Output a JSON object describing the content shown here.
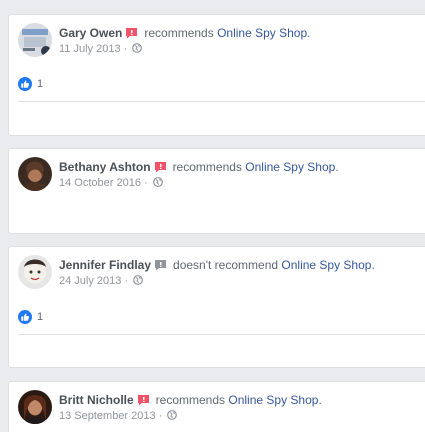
{
  "reviews": [
    {
      "author": "Gary Owen",
      "verb": "recommends",
      "page": "Online Spy Shop",
      "punct": ".",
      "date": "11 July 2013",
      "separator": "·",
      "likes": "1",
      "recommend_color": "#f25268"
    },
    {
      "author": "Bethany Ashton",
      "verb": "recommends",
      "page": "Online Spy Shop",
      "punct": ".",
      "date": "14 October 2016",
      "separator": "·",
      "likes": "",
      "recommend_color": "#f25268"
    },
    {
      "author": "Jennifer Findlay",
      "verb": "doesn't recommend",
      "page": "Online Spy Shop",
      "punct": ".",
      "date": "24 July 2013",
      "separator": "·",
      "likes": "1",
      "recommend_color": "#90949c"
    },
    {
      "author": "Britt Nicholle",
      "verb": "recommends",
      "page": "Online Spy Shop",
      "punct": ".",
      "date": "13 September 2013",
      "separator": "·",
      "likes": "",
      "recommend_color": "#f25268"
    }
  ],
  "colors": {
    "link": "#365899",
    "background": "#e9ebee",
    "like_blue": "#2078f4"
  },
  "icons": [
    "recommend-speech-icon",
    "globe-icon",
    "like-reaction-icon"
  ]
}
